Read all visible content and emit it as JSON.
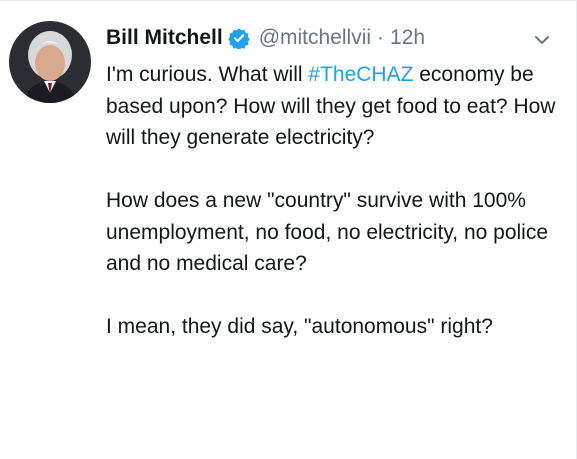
{
  "tweet": {
    "author_name": "Bill Mitchell",
    "handle": "@mitchellvii",
    "separator": "·",
    "time": "12h",
    "text": {
      "p1_before": "I'm curious. What will ",
      "hashtag": "#TheCHAZ",
      "p1_after": " economy be based upon?  How will they get food to eat?  How will they generate electricity?",
      "p2": "How does a new \"country\" survive with 100% unemployment, no food, no electricity, no police and no medical care?",
      "p3": "I mean, they did say, \"autonomous\" right?"
    }
  },
  "icons": {
    "verified": "verified-badge-icon",
    "menu": "chevron-down-icon"
  },
  "colors": {
    "text": "#14171a",
    "secondary": "#657786",
    "link": "#1da1f2",
    "verified": "#1da1f2"
  }
}
